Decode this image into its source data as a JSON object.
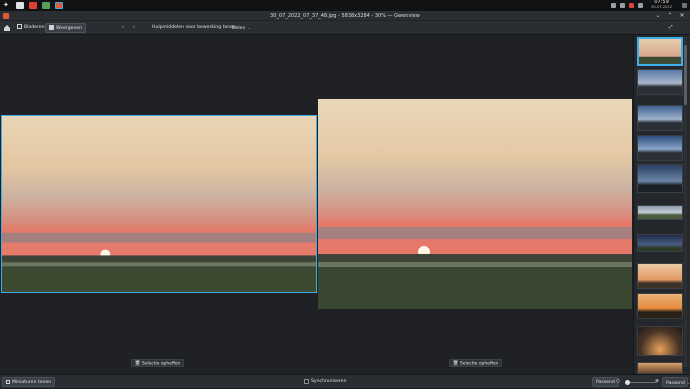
{
  "taskbar": {
    "clock_time": "07:59",
    "clock_date": "30-07-2022"
  },
  "window": {
    "title": "30_07_2022_07_37_48.jpg - 5838x3284 - 30% — Gwenview"
  },
  "toolbar": {
    "browse_label": "Bladeren",
    "view_label": "Weergeven",
    "back_icon": "chevron-left-icon",
    "forward_icon": "chevron-right-icon",
    "tools_label": "Hulpmiddelen voor bewerking tonen",
    "share_label": "Delen",
    "fullscreen_icon": "fullscreen-icon"
  },
  "viewer": {
    "left_deselect_label": "Selectie opheffen",
    "right_deselect_label": "Selectie opheffen"
  },
  "statusbar": {
    "thumbnails_label": "Miniaturen tonen",
    "sync_label": "Synchroniseren",
    "fit_label": "Passend",
    "zoom_select_value": "Passend"
  },
  "colors": {
    "accent": "#3daee9",
    "background": "#1c1e21",
    "toolbar": "#2a2e32"
  }
}
